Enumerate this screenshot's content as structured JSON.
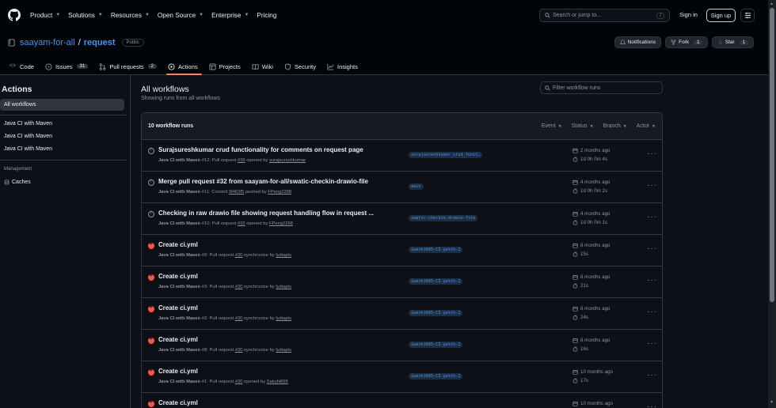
{
  "topnav": {
    "items": [
      "Product",
      "Solutions",
      "Resources",
      "Open Source",
      "Enterprise",
      "Pricing"
    ],
    "search_placeholder": "Search or jump to...",
    "search_shortcut": "/",
    "sign_in": "Sign in",
    "sign_up": "Sign up"
  },
  "repo": {
    "owner": "saayam-for-all",
    "separator": "/",
    "name": "request",
    "visibility": "Public",
    "notifications_label": "Notifications",
    "fork_label": "Fork",
    "fork_count": "1",
    "star_label": "Star",
    "star_count": "1",
    "tabs": [
      {
        "label": "Code",
        "count": ""
      },
      {
        "label": "Issues",
        "count": "31"
      },
      {
        "label": "Pull requests",
        "count": "2"
      },
      {
        "label": "Actions",
        "count": ""
      },
      {
        "label": "Projects",
        "count": ""
      },
      {
        "label": "Wiki",
        "count": ""
      },
      {
        "label": "Security",
        "count": ""
      },
      {
        "label": "Insights",
        "count": ""
      }
    ]
  },
  "sidebar": {
    "title": "Actions",
    "active": "All workflows",
    "workflows": [
      "Java CI with Maven",
      "Java CI with Maven",
      "Java CI with Maven"
    ],
    "management_label": "Management",
    "caches": "Caches"
  },
  "main": {
    "title": "All workflows",
    "subtitle": "Showing runs from all workflows",
    "filter_placeholder": "Filter workflow runs",
    "runs_count": "10 workflow runs",
    "filters": [
      "Event",
      "Status",
      "Branch",
      "Actor"
    ]
  },
  "runs": [
    {
      "status": "neutral",
      "title": "Surajsureshkumar crud functionality for comments on request page",
      "workflow": "Java CI with Maven",
      "run": "#12:",
      "trigger": "Pull request",
      "ref": "#39",
      "action": "opened by",
      "actor": "surajsureshkumar",
      "branch": "surajsureshkumar_crud_funct…",
      "date": "2 months ago",
      "duration": "1d 0h 0m 4s"
    },
    {
      "status": "neutral",
      "title": "Merge pull request #32 from saayam-for-all/swatic-checkin-drawio-file",
      "workflow": "Java CI with Maven",
      "run": "#11:",
      "trigger": "Commit",
      "ref": "9f463f5",
      "action": "pushed by",
      "actor": "FPeng2288",
      "branch": "main",
      "date": "4 months ago",
      "duration": "1d 0h 0m 2s"
    },
    {
      "status": "neutral",
      "title": "Checking in raw drawio file showing request handling flow in request ...",
      "workflow": "Java CI with Maven",
      "run": "#10:",
      "trigger": "Pull request",
      "ref": "#32",
      "action": "opened by",
      "actor": "FPeng2288",
      "branch": "swatic-checkin-drawio-file",
      "date": "4 months ago",
      "duration": "1d 0h 0m 1s"
    },
    {
      "status": "fail",
      "title": "Create ci.yml",
      "workflow": "Java CI with Maven",
      "run": "#9:",
      "trigger": "Pull request",
      "ref": "#20",
      "action": "synchronize by",
      "actor": "lydiaplu",
      "branch": "Sakshi895-CI-patch-2",
      "date": "8 months ago",
      "duration": "15s"
    },
    {
      "status": "fail",
      "title": "Create ci.yml",
      "workflow": "Java CI with Maven",
      "run": "#3:",
      "trigger": "Pull request",
      "ref": "#20",
      "action": "synchronize by",
      "actor": "lydiaplu",
      "branch": "Sakshi895-CI-patch-2",
      "date": "8 months ago",
      "duration": "21s"
    },
    {
      "status": "fail",
      "title": "Create ci.yml",
      "workflow": "Java CI with Maven",
      "run": "#2:",
      "trigger": "Pull request",
      "ref": "#20",
      "action": "synchronize by",
      "actor": "lydiaplu",
      "branch": "Sakshi895-CI-patch-2",
      "date": "8 months ago",
      "duration": "24s"
    },
    {
      "status": "fail",
      "title": "Create ci.yml",
      "workflow": "Java CI with Maven",
      "run": "#8:",
      "trigger": "Pull request",
      "ref": "#20",
      "action": "synchronize by",
      "actor": "lydiaplu",
      "branch": "Sakshi895-CI-patch-2",
      "date": "8 months ago",
      "duration": "16s"
    },
    {
      "status": "fail",
      "title": "Create ci.yml",
      "workflow": "Java CI with Maven",
      "run": "#1:",
      "trigger": "Pull request",
      "ref": "#20",
      "action": "opened by",
      "actor": "Sakshi895",
      "branch": "Sakshi895-CI-patch-2",
      "date": "10 months ago",
      "duration": "17s"
    },
    {
      "status": "fail",
      "title": "Create ci.yml",
      "workflow": "",
      "run": "",
      "trigger": "",
      "ref": "",
      "action": "",
      "actor": "",
      "branch": "",
      "date": "10 months ago",
      "duration": ""
    }
  ],
  "colors": {
    "bg": "#0d1117",
    "header_bg": "#010409",
    "accent_link": "#4493f8",
    "active_tab_underline": "#f78166",
    "fail": "#f85149"
  }
}
